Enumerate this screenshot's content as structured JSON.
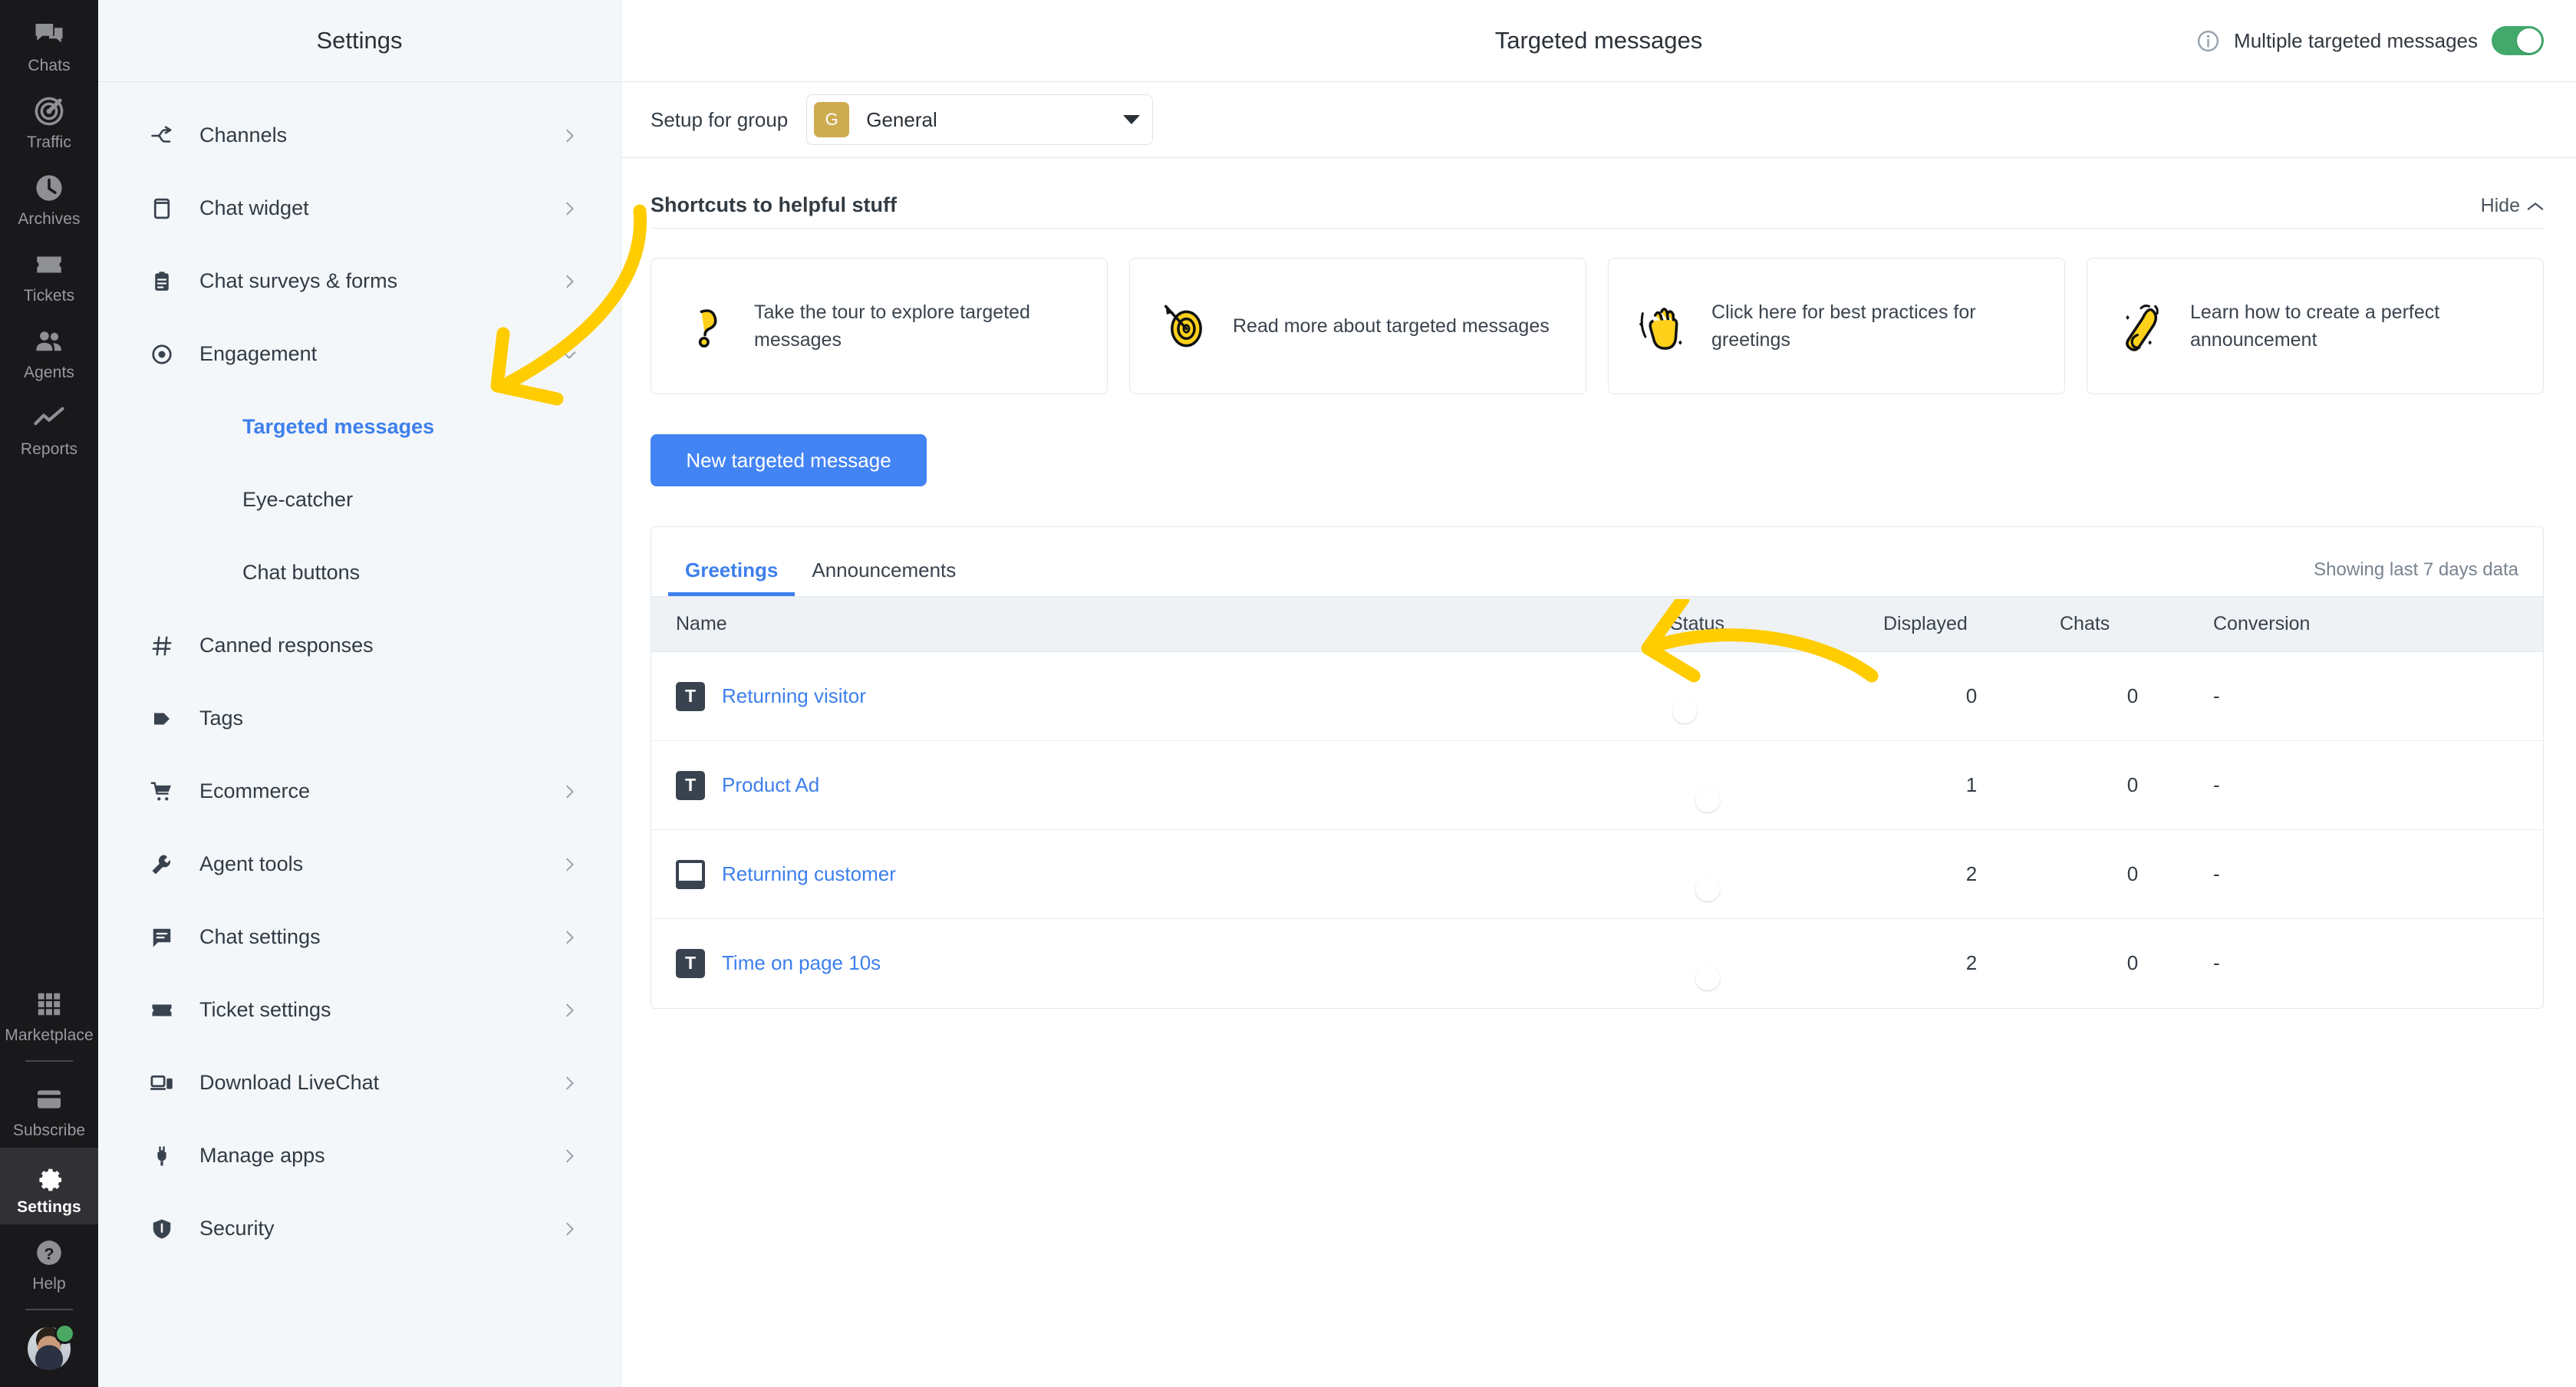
{
  "rail": {
    "items": [
      {
        "label": "Chats",
        "icon": "chats-icon",
        "active": false
      },
      {
        "label": "Traffic",
        "icon": "traffic-icon",
        "active": false
      },
      {
        "label": "Archives",
        "icon": "archives-icon",
        "active": false
      },
      {
        "label": "Tickets",
        "icon": "tickets-icon",
        "active": false
      },
      {
        "label": "Agents",
        "icon": "agents-icon",
        "active": false
      },
      {
        "label": "Reports",
        "icon": "reports-icon",
        "active": false
      }
    ],
    "bottom_items": [
      {
        "label": "Marketplace",
        "icon": "marketplace-icon",
        "active": false
      },
      {
        "label": "Subscribe",
        "icon": "subscribe-icon",
        "active": false
      },
      {
        "label": "Settings",
        "icon": "gear-icon",
        "active": true
      },
      {
        "label": "Help",
        "icon": "help-icon",
        "active": false
      }
    ],
    "avatar_status": "online"
  },
  "settings_nav": {
    "title": "Settings",
    "items": [
      {
        "label": "Channels",
        "icon": "channels-icon",
        "chevron": true
      },
      {
        "label": "Chat widget",
        "icon": "chat-widget-icon",
        "chevron": true
      },
      {
        "label": "Chat surveys & forms",
        "icon": "surveys-icon",
        "chevron": true
      },
      {
        "label": "Engagement",
        "icon": "engagement-eye-icon",
        "chevron": true,
        "expanded": true
      },
      {
        "label": "Canned responses",
        "icon": "hash-icon",
        "chevron": false
      },
      {
        "label": "Tags",
        "icon": "tag-icon",
        "chevron": false
      },
      {
        "label": "Ecommerce",
        "icon": "cart-icon",
        "chevron": true
      },
      {
        "label": "Agent tools",
        "icon": "wrench-icon",
        "chevron": true
      },
      {
        "label": "Chat settings",
        "icon": "chat-settings-icon",
        "chevron": true
      },
      {
        "label": "Ticket settings",
        "icon": "ticket-icon",
        "chevron": true
      },
      {
        "label": "Download LiveChat",
        "icon": "devices-icon",
        "chevron": true
      },
      {
        "label": "Manage apps",
        "icon": "plug-icon",
        "chevron": true
      },
      {
        "label": "Security",
        "icon": "shield-icon",
        "chevron": true
      }
    ],
    "engagement_subitems": [
      {
        "label": "Targeted messages",
        "active": true
      },
      {
        "label": "Eye-catcher",
        "active": false
      },
      {
        "label": "Chat buttons",
        "active": false
      }
    ]
  },
  "header": {
    "title": "Targeted messages",
    "info_icon": "info-icon",
    "toggle_label": "Multiple targeted messages",
    "toggle_on": true
  },
  "group_bar": {
    "label": "Setup for group",
    "badge": "G",
    "selected": "General",
    "badge_color": "#cdab4f"
  },
  "shortcuts": {
    "title": "Shortcuts to helpful stuff",
    "hide_label": "Hide",
    "hide_icon": "chevron-up-icon",
    "cards": [
      {
        "icon": "question-mark-icon",
        "text": "Take the tour to explore targeted messages"
      },
      {
        "icon": "target-dart-icon",
        "text": "Read more about targeted messages"
      },
      {
        "icon": "waving-hand-icon",
        "text": "Click here for best practices for greetings"
      },
      {
        "icon": "megaphone-icon",
        "text": "Learn how to create a perfect announcement"
      }
    ]
  },
  "new_button": {
    "label": "New targeted message",
    "color": "#4384f5"
  },
  "panel": {
    "tabs": [
      {
        "label": "Greetings",
        "active": true
      },
      {
        "label": "Announcements",
        "active": false
      }
    ],
    "showing_text": "Showing last 7 days data",
    "columns": [
      "Name",
      "Status",
      "Displayed",
      "Chats",
      "Conversion"
    ],
    "rows": [
      {
        "icon": "targeted-message-t-icon",
        "name": "Returning visitor",
        "status_on": false,
        "displayed": "0",
        "chats": "0",
        "conversion": "-"
      },
      {
        "icon": "targeted-message-t-icon",
        "name": "Product Ad",
        "status_on": true,
        "displayed": "1",
        "chats": "0",
        "conversion": "-"
      },
      {
        "icon": "announcement-window-icon",
        "name": "Returning customer",
        "status_on": true,
        "displayed": "2",
        "chats": "0",
        "conversion": "-"
      },
      {
        "icon": "targeted-message-t-icon",
        "name": "Time on page 10s",
        "status_on": true,
        "displayed": "2",
        "chats": "0",
        "conversion": "-"
      }
    ]
  },
  "annotations": {
    "arrow_color": "#FFCC00",
    "arrows": [
      {
        "name": "arrow-to-targeted-messages"
      },
      {
        "name": "arrow-to-new-targeted-message-button"
      }
    ]
  }
}
